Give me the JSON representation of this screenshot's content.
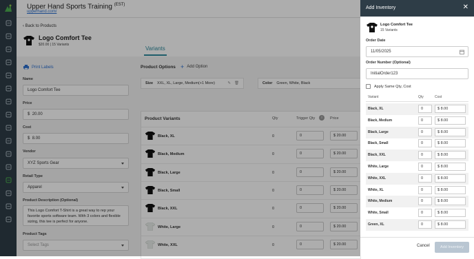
{
  "header": {
    "title": "Upper Hand Sports Training",
    "timezone": "(EST)",
    "url": "upperhand.com/"
  },
  "sidebar": {
    "icons": [
      "logo-icon",
      "dashboard-icon",
      "calendar-icon",
      "clipboard-icon",
      "whistle-icon",
      "schedule-icon",
      "users-icon",
      "people-icon",
      "chat-icon",
      "list-icon",
      "report-icon",
      "ticket-icon",
      "book-icon",
      "tag-icon",
      "price-tag-icon",
      "settings-icon",
      "edit-icon"
    ]
  },
  "product": {
    "back_label": "Back to Products",
    "name": "Logo Comfort Tee",
    "subtitle": "$20.00 | 15 Variants",
    "print_label": "Print Labels",
    "tab_variants": "Variants",
    "fields": {
      "name_label": "Name",
      "name_value": "Logo Comfort Tee",
      "price_label": "Price",
      "price_value": "20.00",
      "cost_label": "Cost",
      "cost_value": "8.00",
      "currency": "$",
      "vendor_label": "Vendor",
      "vendor_value": "XYZ Sports Gear",
      "retail_type_label": "Retail Type",
      "retail_type_value": "Apparel",
      "description_label": "Product Description (Optional)",
      "description_value": "This Logo Comfort T-Shirt is a great way to rep your favorite sports software team. With 3 colors and flexible sizing, this tee is perfect for anyone.",
      "tags_label": "Product Tags",
      "tags_placeholder": "Select Tags"
    }
  },
  "options": {
    "title": "Product Options",
    "add_label": "Add Option",
    "size_label": "Size",
    "size_values": "XXL, XL, Large, Medium(+1 More)",
    "color_label": "Color",
    "color_values": "Green, White, Black"
  },
  "variants_table": {
    "title": "Product Variants",
    "col_qty": "Qty",
    "col_trigger": "Trigger Qty",
    "col_price": "Price",
    "rows": [
      {
        "name": "Black, XL",
        "qty": "0",
        "trigger": "0",
        "price": "20.00",
        "color": "black"
      },
      {
        "name": "Black, Medium",
        "qty": "0",
        "trigger": "0",
        "price": "20.00",
        "color": "black"
      },
      {
        "name": "Black, Large",
        "qty": "0",
        "trigger": "0",
        "price": "20.00",
        "color": "black"
      },
      {
        "name": "Black, Small",
        "qty": "0",
        "trigger": "0",
        "price": "20.00",
        "color": "black"
      },
      {
        "name": "Black, XXL",
        "qty": "0",
        "trigger": "0",
        "price": "20.00",
        "color": "black"
      },
      {
        "name": "White, Large",
        "qty": "0",
        "trigger": "0",
        "price": "20.00",
        "color": "white"
      },
      {
        "name": "White, XXL",
        "qty": "0",
        "trigger": "0",
        "price": "20.00",
        "color": "white"
      }
    ]
  },
  "panel": {
    "title": "Add Inventory",
    "product_name": "Logo Comfort Tee",
    "product_sub": "15 Variants",
    "order_date_label": "Order Date",
    "order_date_value": "11/05/2025",
    "order_number_label": "Order Number (Optional)",
    "order_number_value": "InitialOrder123",
    "apply_same_label": "Apply Same Qty, Cost",
    "col_variant": "Variant",
    "col_qty": "Qty",
    "col_cost": "Cost",
    "rows": [
      {
        "name": "Black, XL",
        "qty": "0",
        "cost": "8.00"
      },
      {
        "name": "Black, Medium",
        "qty": "0",
        "cost": "8.00"
      },
      {
        "name": "Black, Large",
        "qty": "0",
        "cost": "8.00"
      },
      {
        "name": "Black, Small",
        "qty": "0",
        "cost": "8.00"
      },
      {
        "name": "Black, XXL",
        "qty": "0",
        "cost": "8.00"
      },
      {
        "name": "White, Large",
        "qty": "0",
        "cost": "8.00"
      },
      {
        "name": "White, XXL",
        "qty": "0",
        "cost": "8.00"
      },
      {
        "name": "White, XL",
        "qty": "0",
        "cost": "8.00"
      },
      {
        "name": "White, Medium",
        "qty": "0",
        "cost": "8.00"
      },
      {
        "name": "White, Small",
        "qty": "0",
        "cost": "8.00"
      },
      {
        "name": "Green, XL",
        "qty": "0",
        "cost": "8.00"
      }
    ],
    "cancel_label": "Cancel",
    "submit_label": "Add Inventory"
  },
  "colors": {
    "sidebar_bg": "#2e3d47",
    "accent": "#2f8a9c",
    "link": "#2a6fcf",
    "brand_green": "#4caf50"
  }
}
